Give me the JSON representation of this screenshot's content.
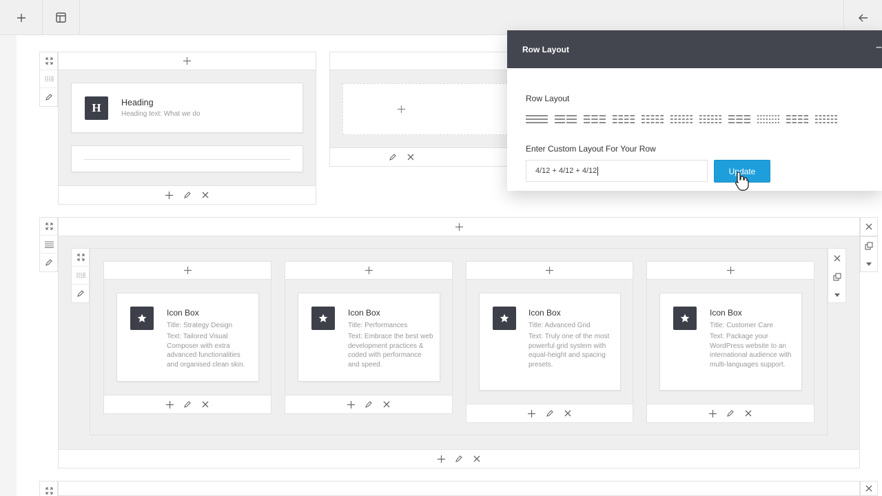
{
  "toolbar": {
    "add_icon": "plus-icon",
    "layout_icon": "layout-icon",
    "back_icon": "arrow-left-icon"
  },
  "row1": {
    "col1": {
      "heading": {
        "icon_letter": "H",
        "title": "Heading",
        "sub_label": "Heading text:",
        "sub_value": "What we do"
      }
    }
  },
  "row2": {
    "boxes": [
      {
        "title": "Icon Box",
        "title_label": "Title:",
        "title_value": "Strategy Design",
        "text_label": "Text:",
        "text_value": "Tailored Visual Composer with extra advanced functionalities and organised clean skin."
      },
      {
        "title": "Icon Box",
        "title_label": "Title:",
        "title_value": "Performances",
        "text_label": "Text:",
        "text_value": "Embrace the best web development practices & coded with performance and speed."
      },
      {
        "title": "Icon Box",
        "title_label": "Title:",
        "title_value": "Advanced Grid",
        "text_label": "Text:",
        "text_value": "Truly one of the most powerful grid system with equal-height and spacing presets."
      },
      {
        "title": "Icon Box",
        "title_label": "Title:",
        "title_value": "Customer Care",
        "text_label": "Text:",
        "text_value": "Package your WordPress website to an international audience with multi-languages support."
      }
    ]
  },
  "panel": {
    "title": "Row Layout",
    "minimize": "–",
    "section_label": "Row Layout",
    "custom_label": "Enter Custom Layout For Your Row",
    "custom_value": "4/12 + 4/12 + 4/12",
    "update_label": "Update",
    "layouts": [
      1,
      2,
      3,
      4,
      5,
      6,
      6,
      3,
      8,
      4,
      6
    ]
  },
  "colors": {
    "dark": "#44464f",
    "accent": "#1e9fdc"
  }
}
